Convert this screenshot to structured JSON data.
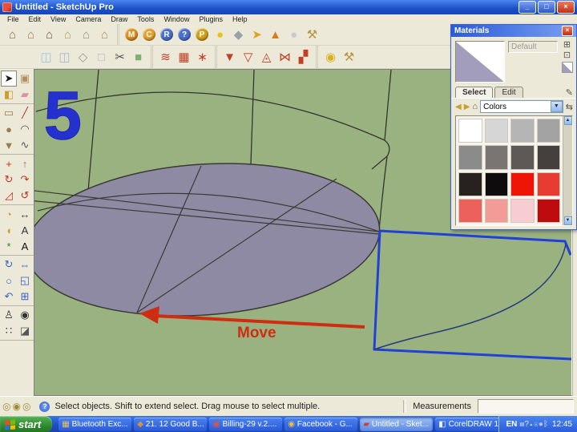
{
  "window": {
    "title": "Untitled - SketchUp Pro",
    "controls": {
      "minimize": "_",
      "restore": "□",
      "close": "×"
    }
  },
  "menu": {
    "items": [
      "File",
      "Edit",
      "View",
      "Camera",
      "Draw",
      "Tools",
      "Window",
      "Plugins",
      "Help"
    ]
  },
  "toolbars": {
    "row1_groups": [
      [
        {
          "name": "view-iso",
          "glyph": "⌂",
          "color": "#8a6d4a"
        },
        {
          "name": "view-side",
          "glyph": "⌂",
          "color": "#9b7d55"
        },
        {
          "name": "view-front",
          "glyph": "⌂",
          "color": "#6a5a40"
        },
        {
          "name": "view-top",
          "glyph": "⌂",
          "color": "#b59a6d"
        },
        {
          "name": "view-back",
          "glyph": "⌂",
          "color": "#8d8d7d"
        },
        {
          "name": "view-plan",
          "glyph": "⌂",
          "color": "#a8906a"
        }
      ],
      [
        {
          "name": "model-info",
          "glyph": "M",
          "color": "#fff",
          "bg": "#e09020"
        },
        {
          "name": "components",
          "glyph": "C",
          "color": "#fff",
          "bg": "#e8a030"
        },
        {
          "name": "reference",
          "glyph": "R",
          "color": "#fff",
          "bg": "#4a6fd0"
        },
        {
          "name": "help-coin",
          "glyph": "?",
          "color": "#fff",
          "bg": "#4a6fd0"
        },
        {
          "name": "pro-tag",
          "glyph": "P",
          "color": "#fff",
          "bg": "#d4a017"
        },
        {
          "name": "sphere-yellow",
          "glyph": "●",
          "color": "#e8c020"
        },
        {
          "name": "layers-diamond",
          "glyph": "◆",
          "color": "#9aa0a8"
        },
        {
          "name": "flag",
          "glyph": "➤",
          "color": "#e0a020"
        },
        {
          "name": "cone",
          "glyph": "▲",
          "color": "#d08020"
        },
        {
          "name": "globe",
          "glyph": "●",
          "color": "#c8c8d0"
        },
        {
          "name": "toolbox",
          "glyph": "⚒",
          "color": "#b8963f"
        }
      ]
    ],
    "row2_groups": [
      [
        {
          "name": "x-ray",
          "glyph": "◫",
          "color": "#9ec7e8"
        },
        {
          "name": "back-edges",
          "glyph": "◫",
          "color": "#a8b8d0"
        },
        {
          "name": "wireframe",
          "glyph": "◇",
          "color": "#9a9a9a"
        },
        {
          "name": "hidden-line",
          "glyph": "□",
          "color": "#b8b8b8"
        },
        {
          "name": "section-cut",
          "glyph": "✂",
          "color": "#555555"
        },
        {
          "name": "shaded",
          "glyph": "■",
          "color": "#7fb070"
        }
      ],
      [
        {
          "name": "sandbox-from-contours",
          "glyph": "≋",
          "color": "#c04028"
        },
        {
          "name": "sandbox-from-scratch",
          "glyph": "▦",
          "color": "#c04028"
        },
        {
          "name": "smoove",
          "glyph": "∗",
          "color": "#c04028"
        }
      ],
      [
        {
          "name": "stamp",
          "glyph": "▼",
          "color": "#c04028"
        },
        {
          "name": "drape",
          "glyph": "▽",
          "color": "#c04028"
        },
        {
          "name": "add-detail",
          "glyph": "◬",
          "color": "#c04028"
        },
        {
          "name": "flip-edge",
          "glyph": "⋈",
          "color": "#c04028"
        },
        {
          "name": "terrain",
          "glyph": "▞",
          "color": "#c04028"
        }
      ],
      [
        {
          "name": "survey",
          "glyph": "◉",
          "color": "#d8b020"
        },
        {
          "name": "utilities",
          "glyph": "⚒",
          "color": "#b8963f"
        }
      ]
    ]
  },
  "palette": {
    "groups": [
      [
        {
          "name": "select-tool",
          "glyph": "➤",
          "color": "#1a1a1a",
          "active": true
        },
        {
          "name": "make-component",
          "glyph": "▣",
          "color": "#b09060"
        },
        {
          "name": "paint-bucket",
          "glyph": "◧",
          "color": "#c8a030"
        },
        {
          "name": "eraser",
          "glyph": "▰",
          "color": "#e090a0"
        }
      ],
      [
        {
          "name": "rectangle-tool",
          "glyph": "▭",
          "color": "#9a7b4f"
        },
        {
          "name": "line-tool",
          "glyph": "╱",
          "color": "#b03828"
        },
        {
          "name": "circle-tool",
          "glyph": "●",
          "color": "#9a7b4f"
        },
        {
          "name": "arc-tool",
          "glyph": "◠",
          "color": "#555555"
        },
        {
          "name": "polygon-tool",
          "glyph": "▼",
          "color": "#9a7b4f"
        },
        {
          "name": "freehand-tool",
          "glyph": "∿",
          "color": "#555555"
        }
      ],
      [
        {
          "name": "move-tool",
          "glyph": "+",
          "color": "#c43020"
        },
        {
          "name": "push-pull-tool",
          "glyph": "↑",
          "color": "#9a7b4f"
        },
        {
          "name": "rotate-tool",
          "glyph": "↻",
          "color": "#c43020"
        },
        {
          "name": "follow-me-tool",
          "glyph": "↷",
          "color": "#c43020"
        },
        {
          "name": "scale-tool",
          "glyph": "◿",
          "color": "#c43020"
        },
        {
          "name": "offset-tool",
          "glyph": "↺",
          "color": "#c43020"
        }
      ],
      [
        {
          "name": "tape-measure-tool",
          "glyph": "◔",
          "color": "#c8a030"
        },
        {
          "name": "dimension-tool",
          "glyph": "↔",
          "color": "#444444"
        },
        {
          "name": "protractor-tool",
          "glyph": "◖",
          "color": "#c8a030"
        },
        {
          "name": "text-tool",
          "glyph": "A",
          "color": "#333333"
        },
        {
          "name": "axes-tool",
          "glyph": "*",
          "color": "#2a8a2a"
        },
        {
          "name": "3d-text-tool",
          "glyph": "A",
          "color": "#111111"
        }
      ],
      [
        {
          "name": "orbit-tool",
          "glyph": "↻",
          "color": "#3a62c8"
        },
        {
          "name": "pan-tool",
          "glyph": "⇔",
          "color": "#3a62c8"
        },
        {
          "name": "zoom-tool",
          "glyph": "○",
          "color": "#3a62c8"
        },
        {
          "name": "zoom-window-tool",
          "glyph": "◱",
          "color": "#3a62c8"
        },
        {
          "name": "zoom-previous-tool",
          "glyph": "↶",
          "color": "#3a62c8"
        },
        {
          "name": "zoom-extents-tool",
          "glyph": "⊞",
          "color": "#3a62c8"
        }
      ],
      [
        {
          "name": "position-camera-tool",
          "glyph": "♙",
          "color": "#333333"
        },
        {
          "name": "look-around-tool",
          "glyph": "◉",
          "color": "#333333"
        },
        {
          "name": "walk-tool",
          "glyph": "∷",
          "color": "#333333"
        },
        {
          "name": "section-plane-tool",
          "glyph": "◪",
          "color": "#555555"
        }
      ]
    ]
  },
  "viewport": {
    "step_number": "5",
    "move_label": "Move",
    "annotation_color": "#cf2d12",
    "number_color": "#2531cf",
    "background_color": "#9ab280",
    "face_color": "#8f8aa3",
    "edge_color": "#34342f",
    "selection_color": "#2140d8"
  },
  "materials": {
    "title": "Materials",
    "default_label": "Default",
    "tabs": [
      "Select",
      "Edit"
    ],
    "dropdown_value": "Colors",
    "icons": {
      "close": "×",
      "create": "⊞",
      "paint_default": "⊡",
      "eyedropper": "✎",
      "nav_back": "◀",
      "nav_forward": "▶",
      "home": "⌂",
      "dropdown_arrow": "▼",
      "swap": "⇆",
      "scroll_up": "▲",
      "scroll_down": "▼"
    },
    "swatches": [
      "#ffffff",
      "#d6d6d6",
      "#b5b5b5",
      "#a3a3a3",
      "#8b8b8b",
      "#7a7472",
      "#5e5856",
      "#453f3d",
      "#272120",
      "#0e0c0c",
      "#ee1507",
      "#e73c31",
      "#ec615c",
      "#f29b97",
      "#f7cdd1",
      "#c00b0e"
    ]
  },
  "statusbar": {
    "rings": [
      {
        "name": "geo-location",
        "glyph": "◎",
        "color": "#a08a3a"
      },
      {
        "name": "claim-credit",
        "glyph": "◉",
        "color": "#a08a3a"
      },
      {
        "name": "sign-in",
        "glyph": "◎",
        "color": "#a08a3a"
      }
    ],
    "help_glyph": "?",
    "hint": "Select objects. Shift to extend select. Drag mouse to select multiple.",
    "measurements_label": "Measurements",
    "measurements_value": ""
  },
  "taskbar": {
    "start_label": "start",
    "items": [
      {
        "name": "bluetooth-window",
        "label": "Bluetooth Exc...",
        "glyph": "▦",
        "color": "#e9c35b",
        "active": false
      },
      {
        "name": "good-b-window",
        "label": "21. 12 Good B...",
        "glyph": "◆",
        "color": "#e09030",
        "active": false
      },
      {
        "name": "billing-window",
        "label": "Billing-29 v.2....",
        "glyph": "▣",
        "color": "#d4564a",
        "active": false
      },
      {
        "name": "facebook-window",
        "label": "Facebook - G...",
        "glyph": "◉",
        "color": "#f0c040",
        "active": false
      },
      {
        "name": "sketchup-window",
        "label": "Untitled - Sket...",
        "glyph": "▰",
        "color": "#d04030",
        "active": true
      },
      {
        "name": "coreldraw-window",
        "label": "CorelDRAW 1...",
        "glyph": "◧",
        "color": "#f0f0f0",
        "active": false
      }
    ],
    "tray_language": "EN",
    "tray_icons": [
      {
        "name": "keyboard",
        "glyph": "▤",
        "color": "#cfe0f8"
      },
      {
        "name": "help-tray",
        "glyph": "?",
        "color": "#f0e8c0"
      },
      {
        "name": "show-hidden",
        "glyph": "▴",
        "color": "#e8f0ff"
      },
      {
        "name": "skype",
        "glyph": "◉",
        "color": "#8ac4f0"
      },
      {
        "name": "messenger",
        "glyph": "●",
        "color": "#b8c4d4"
      },
      {
        "name": "bluetooth-tray",
        "glyph": "ᛒ",
        "color": "#cfe4ff"
      }
    ],
    "tray_time": "12:45"
  }
}
